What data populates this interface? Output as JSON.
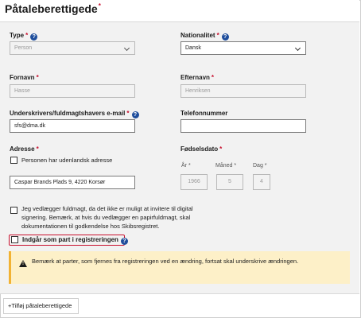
{
  "header": {
    "title": "Påtaleberettigede",
    "required_mark": "*"
  },
  "fields": {
    "type": {
      "label": "Type",
      "value": "Person"
    },
    "nationality": {
      "label": "Nationalitet",
      "value": "Dansk"
    },
    "first_name": {
      "label": "Fornavn",
      "value": "Hasse"
    },
    "last_name": {
      "label": "Efternavn",
      "value": "Henriksen"
    },
    "email": {
      "label": "Underskrivers/fuldmagtshavers e-mail",
      "value": "sfs@dma.dk"
    },
    "phone": {
      "label": "Telefonnummer",
      "value": ""
    },
    "address": {
      "label": "Adresse",
      "foreign_checkbox_label": "Personen har udenlandsk adresse",
      "value": "Caspar Brands Plads 9, 4220 Korsør"
    },
    "birthdate": {
      "label": "Fødselsdato",
      "year_label": "År",
      "month_label": "Måned",
      "day_label": "Dag",
      "year": "1966",
      "month": "5",
      "day": "4"
    }
  },
  "required_mark": "*",
  "help_icon_glyph": "?",
  "consent": {
    "text": "Jeg vedlægger fuldmagt, da det ikke er muligt at invitere til digital signering. Bemærk, at hvis du vedlægger en papirfuldmagt, skal dokumentationen til godkendelse hos Skibsregistret."
  },
  "party": {
    "label": "Indgår som part i registreringen"
  },
  "warning": {
    "text": "Bemærk at parter, som fjernes fra registreringen ved en ændring, fortsat skal underskrive ændringen."
  },
  "actions": {
    "add_label": "+Tilføj påtaleberettigede"
  },
  "colors": {
    "required": "#c8102e",
    "help": "#1f4e9c",
    "warning_bg": "#fdf0c8",
    "warning_border": "#f2b233"
  }
}
